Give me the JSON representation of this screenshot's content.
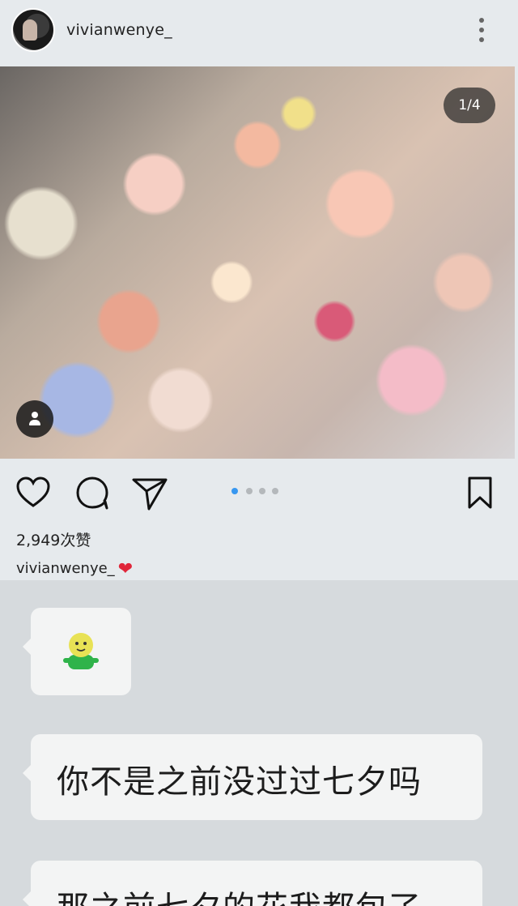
{
  "post": {
    "username": "vivianwenye_",
    "page_counter": "1/4",
    "carousel": {
      "total": 4,
      "current": 1
    },
    "likes": "2,949次赞",
    "caption_user": "vivianwenye_",
    "caption_emoji": "❤",
    "icons": [
      "more-vertical-icon",
      "heart-icon",
      "comment-icon",
      "share-icon",
      "bookmark-icon",
      "tag-people-icon"
    ]
  },
  "chat": {
    "messages": [
      {
        "type": "emoji",
        "icon": "smiley-figure-icon"
      },
      {
        "type": "text",
        "text": "你不是之前没过过七夕吗"
      },
      {
        "type": "text",
        "text": "那之前七夕的花我都包了"
      }
    ]
  },
  "colors": {
    "accent_blue": "#3897f0",
    "heart_red": "#e0263a",
    "post_bg": "#e6eaed",
    "chat_bg": "#d6dadd",
    "bubble_bg": "#f3f4f4"
  }
}
